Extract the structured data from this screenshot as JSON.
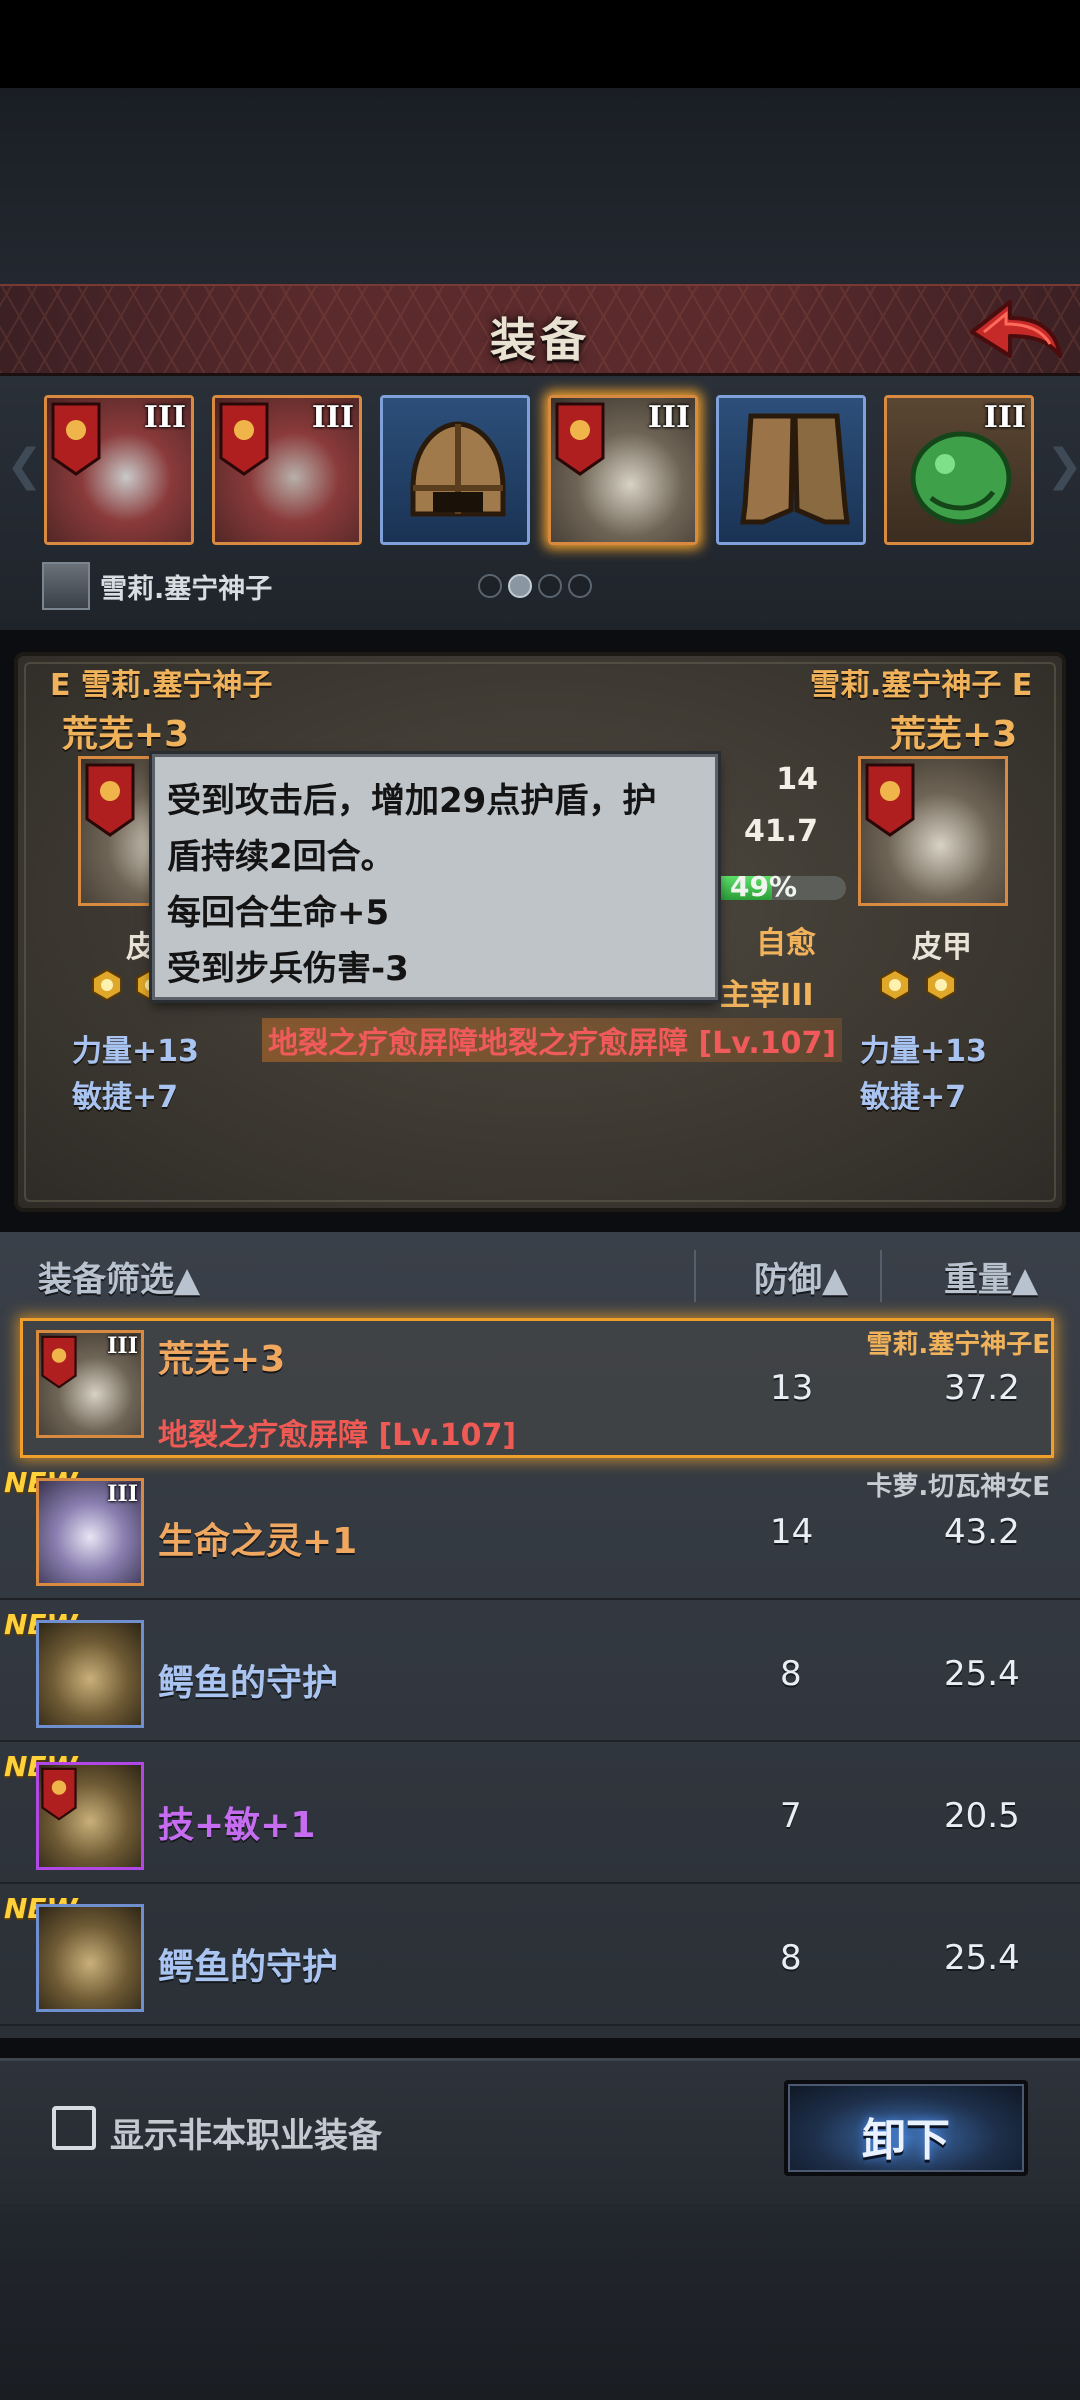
{
  "header": {
    "title": "装备"
  },
  "strip": {
    "character_name": "雪莉.塞宁神子",
    "slots": [
      {
        "tier": "III",
        "item": "red-armor-piece"
      },
      {
        "tier": "III",
        "item": "red-armor-piece"
      },
      {
        "tier": "",
        "item": "leather-helmet"
      },
      {
        "tier": "III",
        "item": "fur-armor"
      },
      {
        "tier": "",
        "item": "leather-boots"
      },
      {
        "tier": "III",
        "item": "jade-charm"
      }
    ],
    "page": 2,
    "pages": 4
  },
  "compare": {
    "left": {
      "owner": "E 雪莉.塞宁神子",
      "name": "荒芜+3",
      "type": "皮",
      "stats": [
        "力量+13",
        "敏捷+7"
      ]
    },
    "right": {
      "owner": "雪莉.塞宁神子 E",
      "name": "荒芜+3",
      "type": "皮甲",
      "stats": [
        "力量+13",
        "敏捷+7"
      ]
    },
    "middle": {
      "defense": "14",
      "weight": "41.7",
      "percent": "49%",
      "percent_value": 0.49,
      "self_heal": "自愈",
      "dominate": "主宰III",
      "skill": "地裂之疗愈屏障地裂之疗愈屏障 [Lv.107]"
    }
  },
  "tooltip": {
    "line1": "受到攻击后，增加29点护盾，护",
    "line2": "盾持续2回合。",
    "line3": "每回合生命+5",
    "line4": "受到步兵伤害-3"
  },
  "list": {
    "headers": {
      "filter": "装备筛选▲",
      "defense": "防御▲",
      "weight": "重量▲"
    },
    "rows": [
      {
        "name": "荒芜+3",
        "skill": "地裂之疗愈屏障 [Lv.107]",
        "owner": "雪莉.塞宁神子E",
        "defense": "13",
        "weight": "37.2",
        "new": ""
      },
      {
        "name": "生命之灵+1",
        "skill": "",
        "owner": "卡萝.切瓦神女E",
        "defense": "14",
        "weight": "43.2",
        "new": "NEW"
      },
      {
        "name": "鳄鱼的守护",
        "skill": "",
        "owner": "",
        "defense": "8",
        "weight": "25.4",
        "new": "NEW"
      },
      {
        "name": "技+敏+1",
        "skill": "",
        "owner": "",
        "defense": "7",
        "weight": "20.5",
        "new": "NEW"
      },
      {
        "name": "鳄鱼的守护",
        "skill": "",
        "owner": "",
        "defense": "8",
        "weight": "25.4",
        "new": "NEW"
      }
    ]
  },
  "footer": {
    "checkbox_label": "显示非本职业装备",
    "unequip_label": "卸下"
  },
  "colors": {
    "gold": "#f0b25a",
    "skill_red": "#f05a5a",
    "stat_blue": "#a9c4f0",
    "rare_purple": "#b148e6"
  }
}
